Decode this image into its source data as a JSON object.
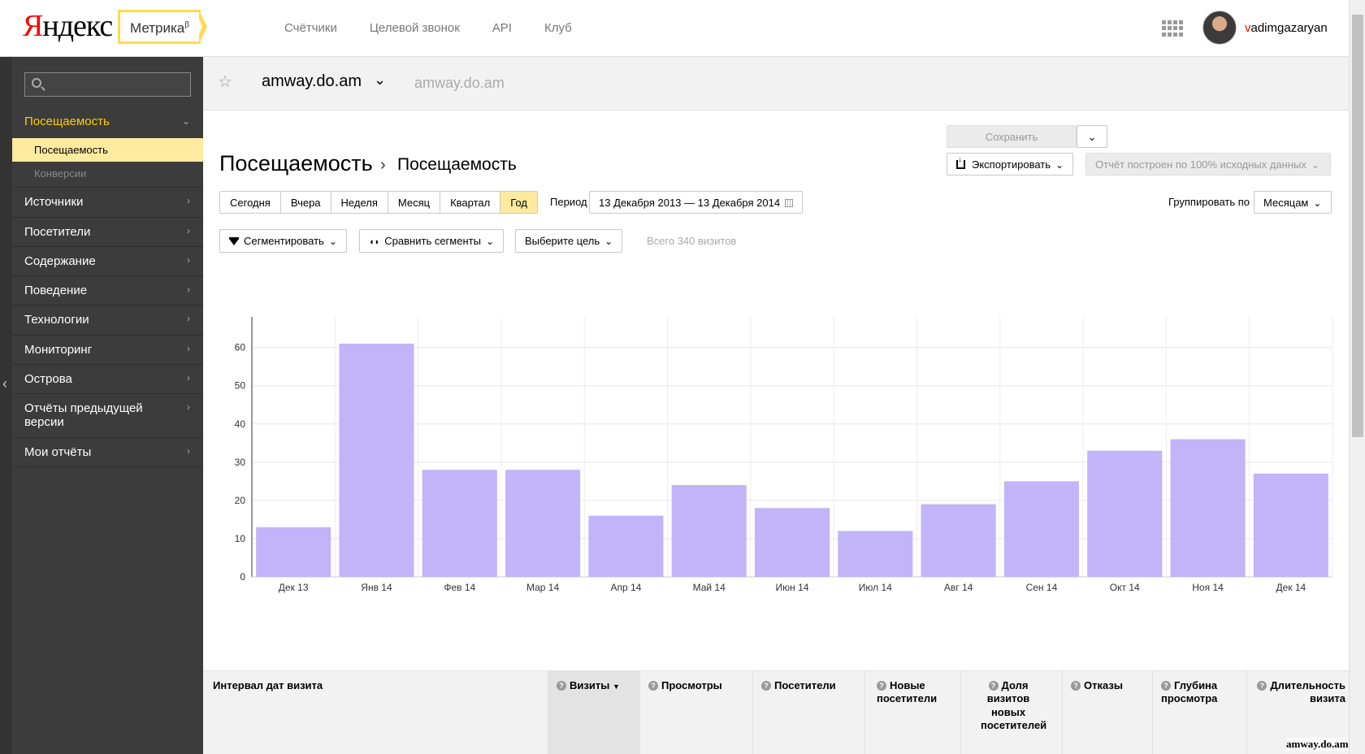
{
  "header": {
    "logo_first": "Я",
    "logo_rest": "ндекс",
    "product": "Метрика",
    "product_sup": "β",
    "nav": [
      "Счётчики",
      "Целевой звонок",
      "API",
      "Клуб"
    ],
    "username_first": "v",
    "username_rest": "adimgazaryan"
  },
  "sidebar": {
    "search_placeholder": "",
    "active_section": "Посещаемость",
    "sub_items": [
      "Посещаемость",
      "Конверсии"
    ],
    "items": [
      "Источники",
      "Посетители",
      "Содержание",
      "Поведение",
      "Технологии",
      "Мониторинг",
      "Острова",
      "Отчёты предыдущей версии",
      "Мои отчёты"
    ]
  },
  "site": {
    "name": "amway.do.am",
    "url": "amway.do.am"
  },
  "page": {
    "title": "Посещаемость",
    "separator": "›",
    "subtitle": "Посещаемость",
    "save": "Сохранить",
    "export": "Экспортировать",
    "report_basis": "Отчёт построен по 100% исходных данных",
    "periods": [
      "Сегодня",
      "Вчера",
      "Неделя",
      "Месяц",
      "Квартал",
      "Год"
    ],
    "active_period": "Год",
    "period_label": "Период",
    "date_range": "13 Декабря 2013 — 13 Декабря 2014",
    "group_label": "Группировать по",
    "group_value": "Месяцам",
    "segment": "Сегментировать",
    "compare": "Сравнить сегменты",
    "goal": "Выберите цель",
    "total": "Всего 340 визитов"
  },
  "chart_data": {
    "type": "bar",
    "categories": [
      "Дек 13",
      "Янв 14",
      "Фев 14",
      "Мар 14",
      "Апр 14",
      "Май 14",
      "Июн 14",
      "Июл 14",
      "Авг 14",
      "Сен 14",
      "Окт 14",
      "Ноя 14",
      "Дек 14"
    ],
    "values": [
      13,
      61,
      28,
      28,
      16,
      24,
      18,
      12,
      19,
      25,
      33,
      36,
      27
    ],
    "yticks": [
      0,
      10,
      20,
      30,
      40,
      50,
      60
    ],
    "ylim": [
      0,
      68
    ],
    "color": "#c3b3f8",
    "grid": true
  },
  "table": {
    "interval": "Интервал дат визита",
    "columns": [
      {
        "label": "Визиты",
        "sort": "▼"
      },
      {
        "label": "Просмотры"
      },
      {
        "label": "Посетители"
      },
      {
        "label": "Новые посетители"
      },
      {
        "label": "Доля визитов новых посетителей"
      },
      {
        "label": "Отказы"
      },
      {
        "label": "Глубина просмотра"
      },
      {
        "label": "Длительность визита"
      }
    ]
  },
  "watermark": "amway.do.am"
}
